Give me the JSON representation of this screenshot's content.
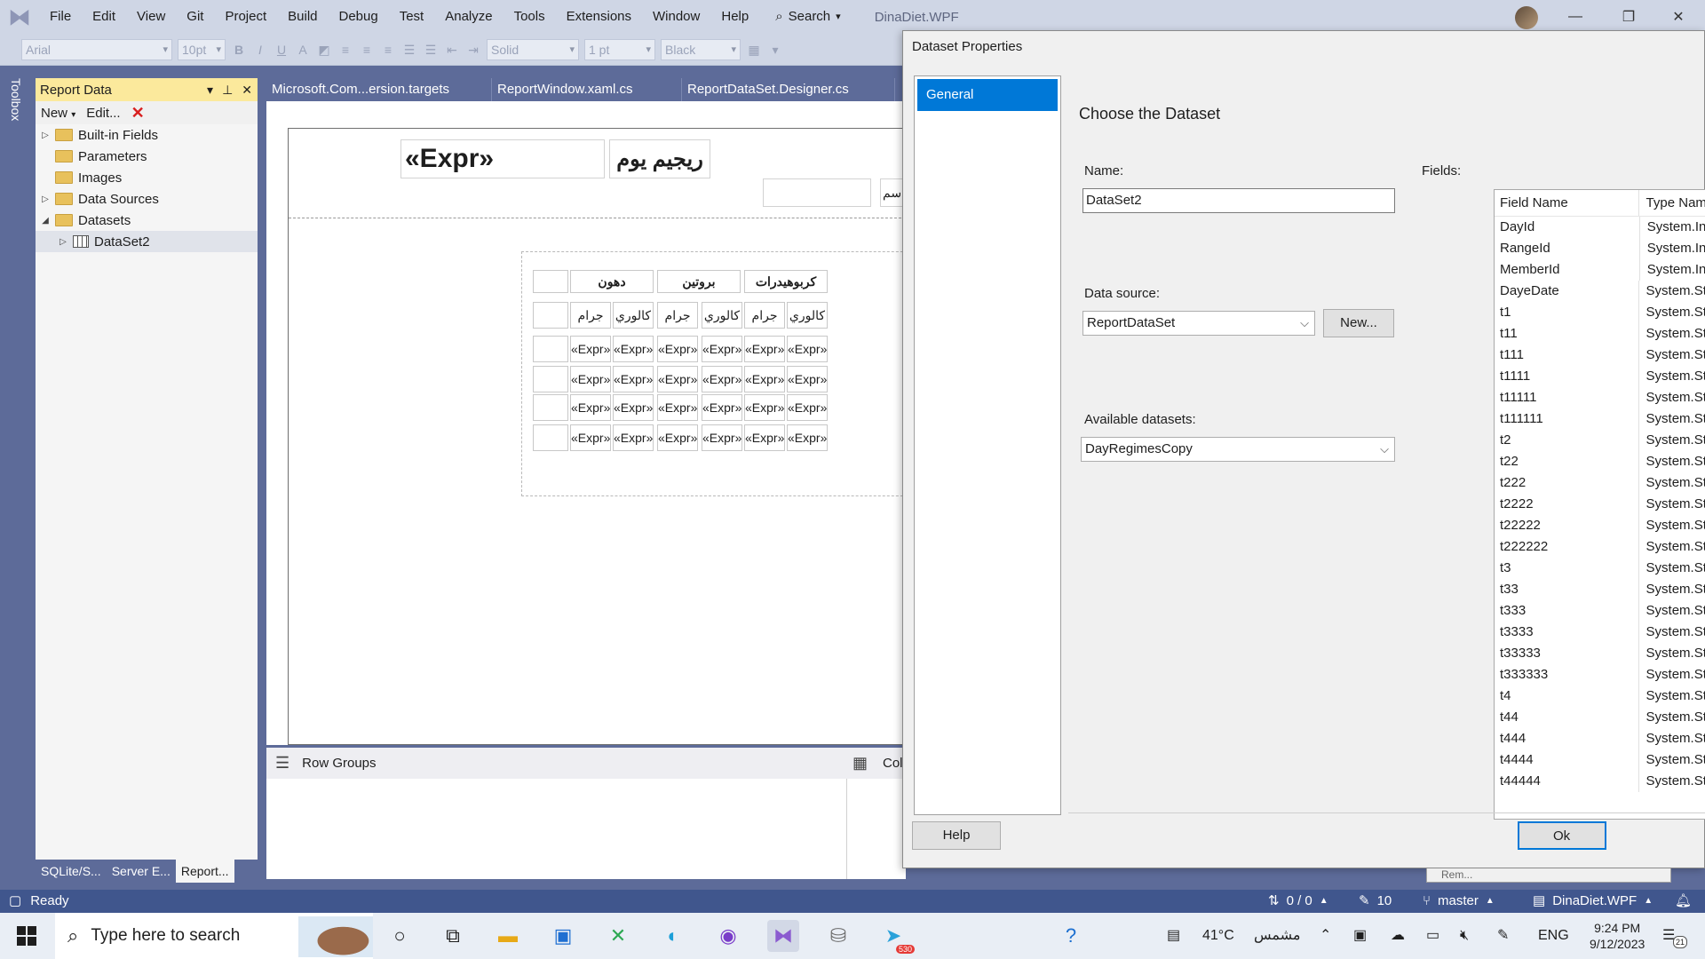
{
  "menubar": {
    "items": [
      "File",
      "Edit",
      "View",
      "Git",
      "Project",
      "Build",
      "Debug",
      "Test",
      "Analyze",
      "Tools",
      "Extensions",
      "Window",
      "Help"
    ],
    "search_label": "Search",
    "solution_title": "DinaDiet.WPF"
  },
  "toolbar": {
    "font_name": "Arial",
    "font_size": "10pt",
    "border_style": "Solid",
    "border_width": "1 pt",
    "border_color": "Black"
  },
  "toolbox": {
    "label": "Toolbox"
  },
  "report_data": {
    "title": "Report Data",
    "new_label": "New",
    "edit_label": "Edit...",
    "tree": [
      {
        "label": "Built-in Fields",
        "expander": "▷"
      },
      {
        "label": "Parameters",
        "expander": ""
      },
      {
        "label": "Images",
        "expander": ""
      },
      {
        "label": "Data Sources",
        "expander": "▷"
      },
      {
        "label": "Datasets",
        "expander": "◢"
      }
    ],
    "dataset_child": "DataSet2",
    "bottom_tabs": [
      "SQLite/S...",
      "Server E...",
      "Report..."
    ]
  },
  "doc_tabs": [
    "Microsoft.Com...ersion.targets",
    "ReportWindow.xaml.cs",
    "ReportDataSet.Designer.cs"
  ],
  "designer": {
    "expr_title": "«Expr»",
    "ar_title": "ريجيم يوم",
    "cut_text": "سم",
    "col_headers": [
      "دهون",
      "بروتين",
      "كربوهيدرات"
    ],
    "sub_headers": [
      "جرام",
      "كالوري",
      "جرام",
      "كالوري",
      "جرام",
      "كالوري"
    ],
    "expr": "«Expr»"
  },
  "groups": {
    "row_groups_label": "Row Groups",
    "col_groups_label": "Col"
  },
  "dialog": {
    "title": "Dataset Properties",
    "nav_general": "General",
    "heading": "Choose the Dataset",
    "name_label": "Name:",
    "name_value": "DataSet2",
    "datasource_label": "Data source:",
    "datasource_value": "ReportDataSet",
    "new_button": "New...",
    "available_label": "Available datasets:",
    "available_value": "DayRegimesCopy",
    "fields_label": "Fields:",
    "col_field_name": "Field Name",
    "col_type_name": "Type Nam",
    "fields": [
      {
        "name": "DayId",
        "type": "System.In"
      },
      {
        "name": "RangeId",
        "type": "System.In"
      },
      {
        "name": "MemberId",
        "type": "System.In"
      },
      {
        "name": "DayeDate",
        "type": "System.St"
      },
      {
        "name": "t1",
        "type": "System.St"
      },
      {
        "name": "t11",
        "type": "System.St"
      },
      {
        "name": "t111",
        "type": "System.St"
      },
      {
        "name": "t1111",
        "type": "System.St"
      },
      {
        "name": "t11111",
        "type": "System.St"
      },
      {
        "name": "t111111",
        "type": "System.St"
      },
      {
        "name": "t2",
        "type": "System.St"
      },
      {
        "name": "t22",
        "type": "System.St"
      },
      {
        "name": "t222",
        "type": "System.St"
      },
      {
        "name": "t2222",
        "type": "System.St"
      },
      {
        "name": "t22222",
        "type": "System.St"
      },
      {
        "name": "t222222",
        "type": "System.St"
      },
      {
        "name": "t3",
        "type": "System.St"
      },
      {
        "name": "t33",
        "type": "System.St"
      },
      {
        "name": "t333",
        "type": "System.St"
      },
      {
        "name": "t3333",
        "type": "System.St"
      },
      {
        "name": "t33333",
        "type": "System.St"
      },
      {
        "name": "t333333",
        "type": "System.St"
      },
      {
        "name": "t4",
        "type": "System.St"
      },
      {
        "name": "t44",
        "type": "System.St"
      },
      {
        "name": "t444",
        "type": "System.St"
      },
      {
        "name": "t4444",
        "type": "System.St"
      },
      {
        "name": "t44444",
        "type": "System.St"
      }
    ],
    "help_button": "Help",
    "ok_button": "Ok",
    "behind_text": "Rem..."
  },
  "statusbar": {
    "ready": "Ready",
    "changes": "0 / 0",
    "edits": "10",
    "branch": "master",
    "repo": "DinaDiet.WPF"
  },
  "taskbar": {
    "search_placeholder": "Type here to search",
    "temperature": "41°C",
    "weather": "مشمس",
    "language": "ENG",
    "time": "9:24 PM",
    "date": "9/12/2023",
    "telegram_badge": "530",
    "notif_count": "21"
  }
}
